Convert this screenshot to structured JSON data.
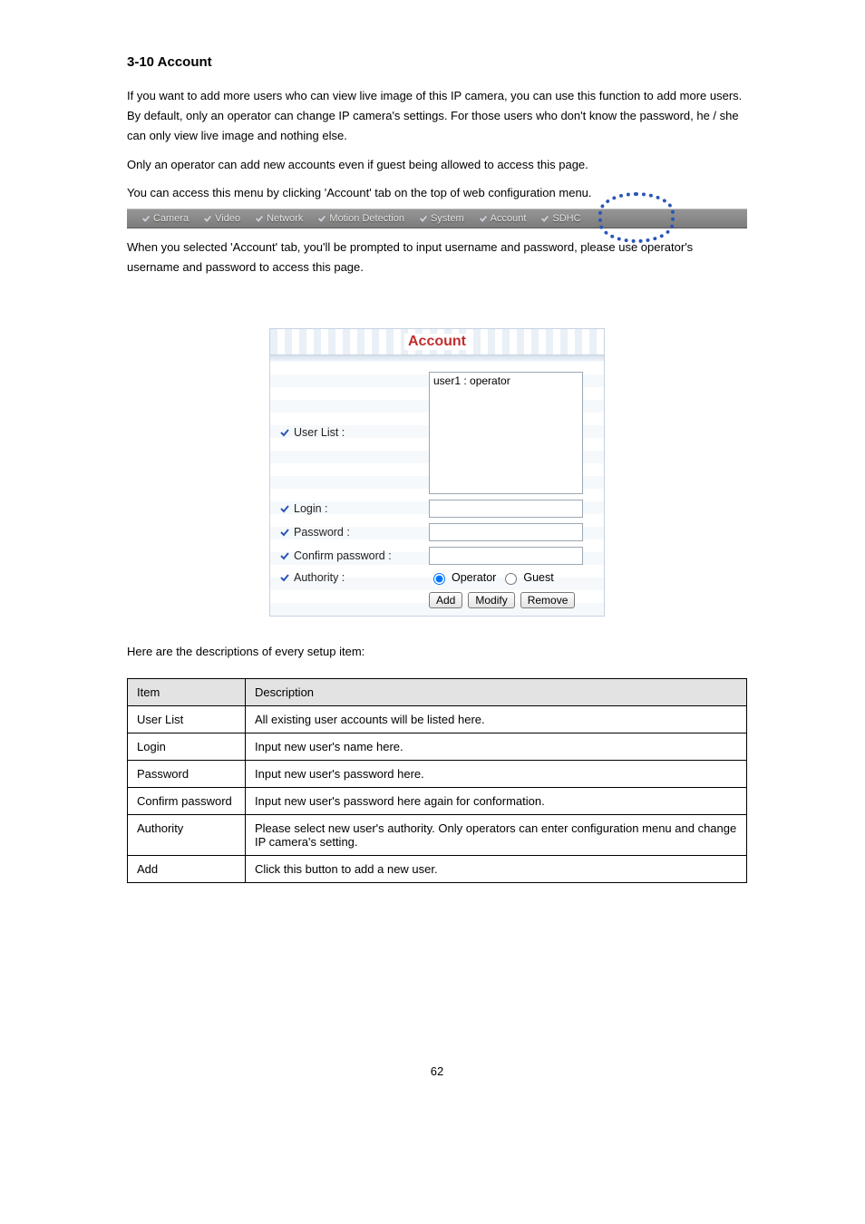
{
  "section": {
    "number": "3-10",
    "title": "Account"
  },
  "intro": "If you want to add more users who can view live image of this IP camera, you can use this function to add more users. By default, only an operator can change IP camera's settings. For those users who don't know the password, he / she can only view live image and nothing else.",
  "note": "Only an operator can add new accounts even if guest being allowed to access this page.",
  "navInstr": "You can access this menu by clicking 'Account' tab on the top of web configuration menu.",
  "navbar": {
    "items": [
      "Camera",
      "Video",
      "Network",
      "Motion Detection",
      "System",
      "Account",
      "SDHC"
    ]
  },
  "afterNav": "When you selected 'Account' tab, you'll be prompted to input username and password, please use operator's username and password to access this page.",
  "panel": {
    "title": "Account",
    "userListLabel": "User List :",
    "userListItems": [
      "user1 : operator"
    ],
    "loginLabel": "Login :",
    "passwordLabel": "Password :",
    "confirmLabel": "Confirm password :",
    "authorityLabel": "Authority :",
    "authorityOptions": {
      "operator": "Operator",
      "guest": "Guest"
    },
    "authoritySelected": "operator",
    "buttons": {
      "add": "Add",
      "modify": "Modify",
      "remove": "Remove"
    }
  },
  "explain": "Here are the descriptions of every setup item:",
  "table": {
    "headers": [
      "Item",
      "Description"
    ],
    "rows": [
      [
        "User List",
        "All existing user accounts will be listed here."
      ],
      [
        "Login",
        "Input new user's name here."
      ],
      [
        "Password",
        "Input new user's password here."
      ],
      [
        "Confirm password",
        "Input new user's password here again for conformation."
      ],
      [
        "Authority",
        "Please select new user's authority. Only operators can enter configuration menu and change IP camera's setting."
      ],
      [
        "Add",
        "Click this button to add a new user."
      ]
    ]
  },
  "pageNumber": "62"
}
